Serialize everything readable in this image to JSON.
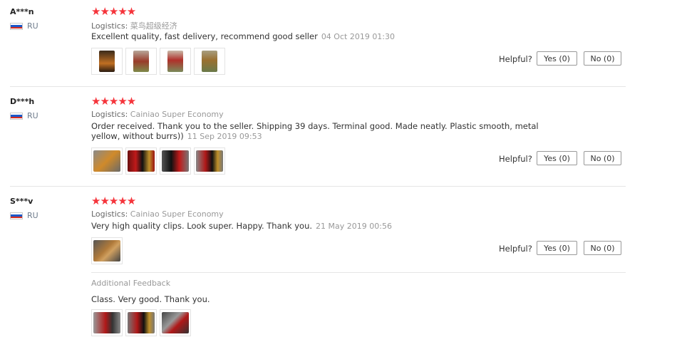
{
  "labels": {
    "logistics": "Logistics:",
    "helpful": "Helpful?",
    "additional_feedback": "Additional Feedback"
  },
  "colors": {
    "star": "#f5343b",
    "meta": "#999999",
    "text": "#333333"
  },
  "reviews": [
    {
      "user": "A***n",
      "country": "RU",
      "stars": "★★★★★",
      "logistics": "菜鸟超级经济",
      "text": "Excellent quality, fast delivery, recommend good seller",
      "date": "04 Oct 2019 01:30",
      "yes": "Yes (0)",
      "no": "No (0)"
    },
    {
      "user": "D***h",
      "country": "RU",
      "stars": "★★★★★",
      "logistics": "Cainiao Super Economy",
      "text": "Order received. Thank you to the seller. Shipping 39 days. Terminal good. Made neatly. Plastic smooth, metal yellow, without burrs))",
      "date": "11 Sep 2019 09:53",
      "yes": "Yes (0)",
      "no": "No (0)"
    },
    {
      "user": "S***v",
      "country": "RU",
      "stars": "★★★★★",
      "logistics": "Cainiao Super Economy",
      "text": "Very high quality clips. Look super. Happy. Thank you.",
      "date": "21 May 2019 00:56",
      "yes": "Yes (0)",
      "no": "No (0)",
      "additional_text": "Class. Very good. Thank you."
    }
  ]
}
